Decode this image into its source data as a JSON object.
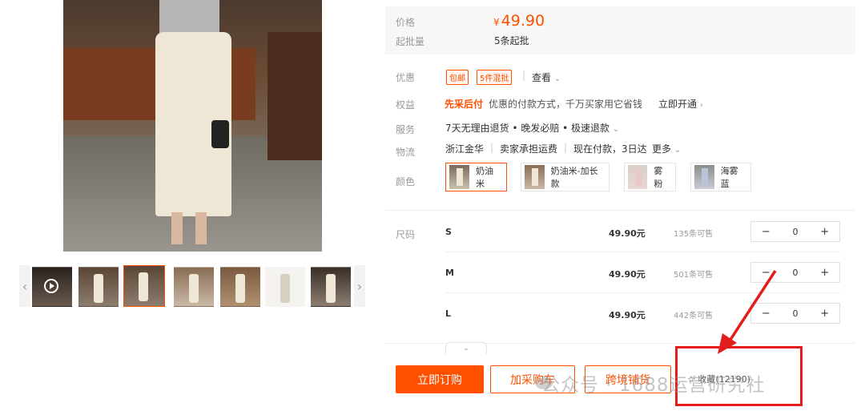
{
  "price_section": {
    "price_label": "价格",
    "currency": "¥",
    "price": "49.90",
    "moq_label": "起批量",
    "moq_value": "5条起批"
  },
  "promo": {
    "label": "优惠",
    "tags": [
      "包邮",
      "5件混批"
    ],
    "view_link": "查看"
  },
  "rights": {
    "label": "权益",
    "highlight": "先采后付",
    "desc": "优惠的付款方式，千万买家用它省钱",
    "activate_link": "立即开通"
  },
  "service": {
    "label": "服务",
    "value": "7天无理由退货 • 晚发必赔 • 极速退款"
  },
  "logistics": {
    "label": "物流",
    "origin": "浙江金华",
    "shipping": "卖家承担运费",
    "delivery": "现在付款，3日达",
    "more_link": "更多"
  },
  "colors": {
    "label": "颜色",
    "options": [
      "奶油米",
      "奶油米-加长款",
      "雾粉",
      "海雾蓝"
    ],
    "selected": "奶油米"
  },
  "sizes": {
    "label": "尺码",
    "rows": [
      {
        "name": "S",
        "price": "49.90元",
        "stock": "135条可售",
        "qty": "0"
      },
      {
        "name": "M",
        "price": "49.90元",
        "stock": "501条可售",
        "qty": "0"
      },
      {
        "name": "L",
        "price": "49.90元",
        "stock": "442条可售",
        "qty": "0"
      }
    ],
    "minus": "−",
    "plus": "+"
  },
  "actions": {
    "buy_now": "立即订购",
    "add_cart": "加采购车",
    "cross_border": "跨境铺货",
    "favorite": "收藏(12190)"
  },
  "watermark": "公众号 · 1688运营研究社",
  "gallery": {
    "prev": "‹",
    "next": "›",
    "collapse": "⌄"
  },
  "colors_theme": {
    "accent": "#ff5000",
    "highlight_box": "#e31c1c"
  }
}
